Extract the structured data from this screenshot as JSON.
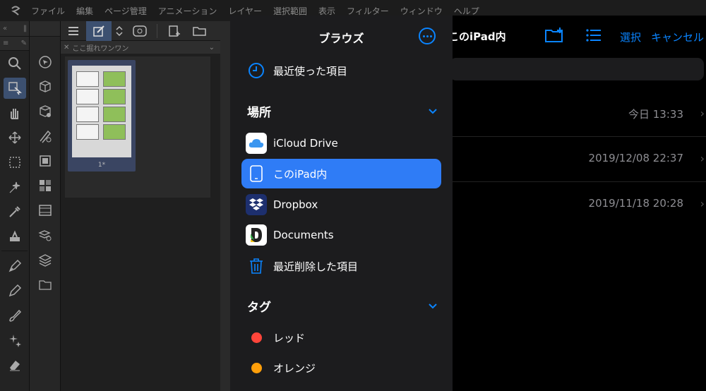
{
  "menubar": {
    "items": [
      "ファイル",
      "編集",
      "ページ管理",
      "アニメーション",
      "レイヤー",
      "選択範囲",
      "表示",
      "フィルター",
      "ウィンドウ",
      "ヘルプ"
    ]
  },
  "pages_panel": {
    "tab_label": "ここ掘れワンワン",
    "page_label": "1*"
  },
  "files": {
    "title": "このiPad内",
    "select_label": "選択",
    "cancel_label": "キャンセル",
    "rows": [
      {
        "date": "今日 13:33"
      },
      {
        "date": "2019/12/08 22:37"
      },
      {
        "date": "2019/11/18 20:28"
      }
    ]
  },
  "browse": {
    "title": "ブラウズ",
    "recents": "最近使った項目",
    "locations_title": "場所",
    "locations": [
      {
        "label": "iCloud Drive",
        "icon": "icloud-icon"
      },
      {
        "label": "このiPad内",
        "icon": "ipad-icon",
        "selected": true
      },
      {
        "label": "Dropbox",
        "icon": "dropbox-icon"
      },
      {
        "label": "Documents",
        "icon": "documents-icon"
      },
      {
        "label": "最近削除した項目",
        "icon": "trash-icon"
      }
    ],
    "tags_title": "タグ",
    "tags": [
      {
        "label": "レッド",
        "color": "#ff453a"
      },
      {
        "label": "オレンジ",
        "color": "#ff9f0a"
      }
    ]
  },
  "colors": {
    "accent": "#0a84ff",
    "selected_bg": "#2f7cf6",
    "sidebar_bg": "#1c1c1e"
  }
}
